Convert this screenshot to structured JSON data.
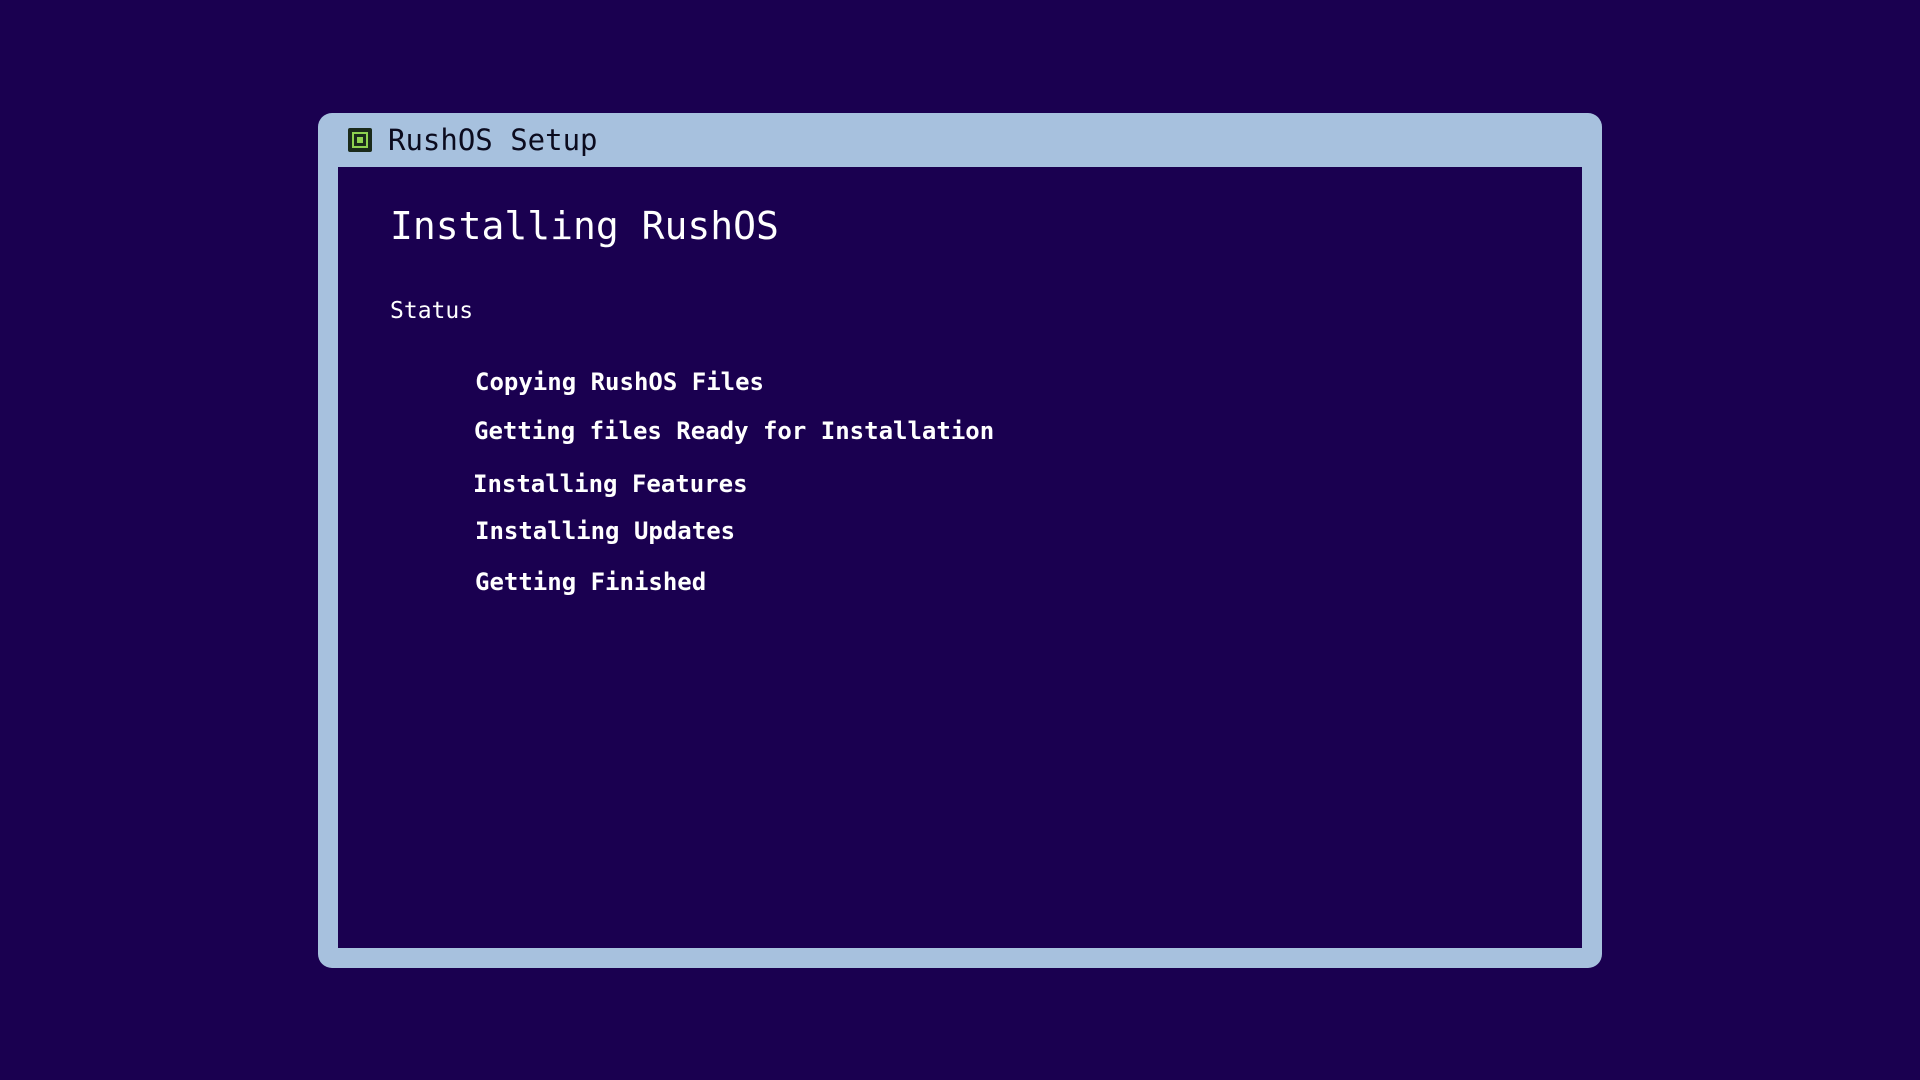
{
  "window": {
    "title": "RushOS Setup",
    "app_icon": "rushos-chip-icon"
  },
  "main": {
    "heading": "Installing RushOS",
    "status_label": "Status",
    "steps": [
      "Copying RushOS Files",
      "Getting files Ready for Installation",
      "Installing Features",
      "Installing Updates",
      "Getting Finished"
    ]
  },
  "colors": {
    "background": "#1a0050",
    "window_frame": "#a7c1de",
    "text": "#ffffff",
    "icon_accent": "#8fd14f"
  }
}
